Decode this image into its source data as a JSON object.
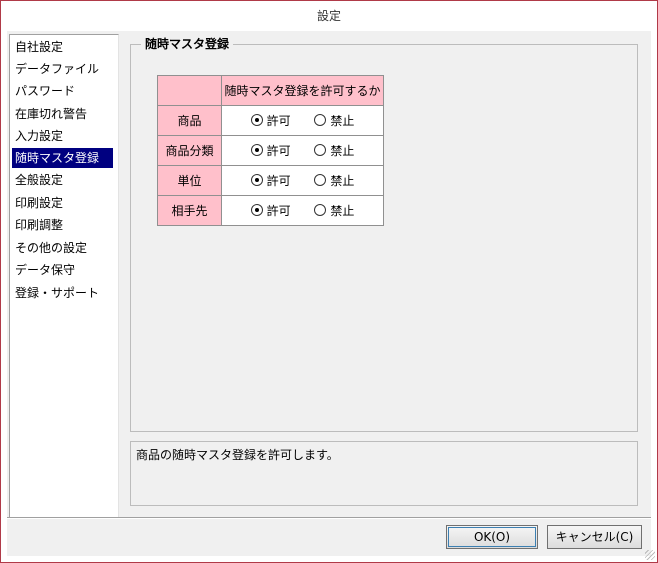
{
  "window": {
    "title": "設定"
  },
  "sidebar": {
    "selected_index": 5,
    "items": [
      {
        "label": "自社設定"
      },
      {
        "label": "データファイル"
      },
      {
        "label": "パスワード"
      },
      {
        "label": "在庫切れ警告"
      },
      {
        "label": "入力設定"
      },
      {
        "label": "随時マスタ登録"
      },
      {
        "label": "全般設定"
      },
      {
        "label": "印刷設定"
      },
      {
        "label": "印刷調整"
      },
      {
        "label": "その他の設定"
      },
      {
        "label": "データ保守"
      },
      {
        "label": "登録・サポート"
      }
    ]
  },
  "panel": {
    "title": "随時マスタ登録",
    "table": {
      "header": "随時マスタ登録を許可するか",
      "option_allow": "許可",
      "option_deny": "禁止",
      "rows": [
        {
          "label": "商品",
          "selected": "許可"
        },
        {
          "label": "商品分類",
          "selected": "許可"
        },
        {
          "label": "単位",
          "selected": "許可"
        },
        {
          "label": "相手先",
          "selected": "許可"
        }
      ]
    },
    "description": "商品の随時マスタ登録を許可します。"
  },
  "footer": {
    "ok_label": "OK(O)",
    "cancel_label": "キャンセル(C)"
  },
  "colors": {
    "selection": "#000080",
    "header_cell": "#ffc0cb",
    "window_border": "#b03a48"
  }
}
